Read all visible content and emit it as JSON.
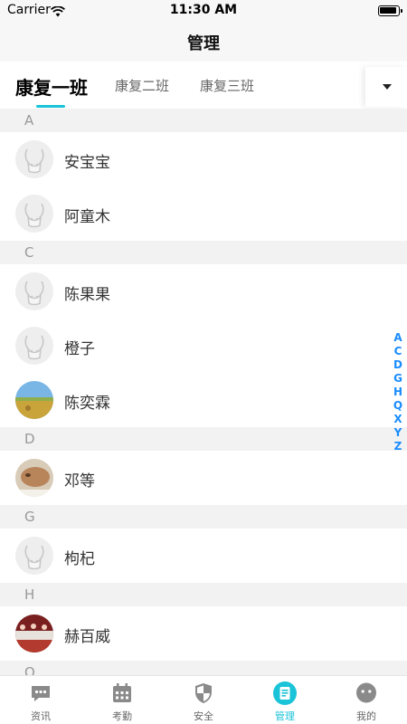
{
  "status_bar": {
    "carrier": "Carrier",
    "time": "11:30 AM"
  },
  "nav": {
    "title": "管理"
  },
  "tabs": [
    {
      "label": "康复一班",
      "active": true
    },
    {
      "label": "康复二班",
      "active": false
    },
    {
      "label": "康复三班",
      "active": false
    }
  ],
  "sections": [
    {
      "letter": "A",
      "names": [
        "安宝宝",
        "阿童木"
      ]
    },
    {
      "letter": "C",
      "names": [
        "陈果果",
        "橙子",
        "陈奕霖"
      ]
    },
    {
      "letter": "D",
      "names": [
        "邓等"
      ]
    },
    {
      "letter": "G",
      "names": [
        "枸杞"
      ]
    },
    {
      "letter": "H",
      "names": [
        "赫百威"
      ]
    },
    {
      "letter": "Q",
      "names": []
    }
  ],
  "index_letters": [
    "A",
    "C",
    "D",
    "G",
    "H",
    "Q",
    "X",
    "Y",
    "Z"
  ],
  "tabbar": [
    {
      "label": "资讯",
      "icon": "chat-icon",
      "active": false
    },
    {
      "label": "考勤",
      "icon": "calendar-icon",
      "active": false
    },
    {
      "label": "安全",
      "icon": "shield-icon",
      "active": false
    },
    {
      "label": "管理",
      "icon": "manage-icon",
      "active": true
    },
    {
      "label": "我的",
      "icon": "profile-icon",
      "active": false
    }
  ],
  "colors": {
    "accent": "#19c3d8",
    "index": "#1a8cff",
    "section_bg": "#f2f2f2"
  }
}
